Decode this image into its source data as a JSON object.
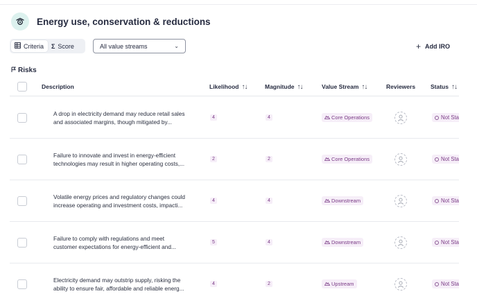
{
  "header": {
    "title": "Energy use, conservation & reductions",
    "icon": "eye-chevron-icon"
  },
  "toolbar": {
    "criteria_label": "Criteria",
    "score_label": "Score",
    "score_icon": "Σ",
    "value_stream_select": "All value streams",
    "add_label": "Add IRO"
  },
  "section": {
    "title": "Risks"
  },
  "table": {
    "columns": {
      "description": "Description",
      "likelihood": "Likelihood",
      "magnitude": "Magnitude",
      "value_stream": "Value Stream",
      "reviewers": "Reviewers",
      "status": "Status"
    },
    "rows": [
      {
        "desc1": "A drop in electricity demand may reduce retail sales",
        "desc2": "and associated margins, though mitigated by...",
        "likelihood": "4",
        "magnitude": "4",
        "value_stream": "Core Operations",
        "status": "Not Sta"
      },
      {
        "desc1": "Failure to innovate and invest in energy-efficient",
        "desc2": "technologies may result in higher operating costs,...",
        "likelihood": "2",
        "magnitude": "2",
        "value_stream": "Core Operations",
        "status": "Not Sta"
      },
      {
        "desc1": "Volatile energy prices and regulatory changes could",
        "desc2": "increase operating and investment costs, impacti...",
        "likelihood": "4",
        "magnitude": "4",
        "value_stream": "Downstream",
        "status": "Not Sta"
      },
      {
        "desc1": "Failure to comply with regulations and meet",
        "desc2": "customer expectations for energy-efficient and...",
        "likelihood": "5",
        "magnitude": "4",
        "value_stream": "Downstream",
        "status": "Not Sta"
      },
      {
        "desc1": "Electricity demand may outstrip supply, risking the",
        "desc2": "ability to ensure fair, affordable and reliable energ...",
        "likelihood": "4",
        "magnitude": "2",
        "value_stream": "Upstream",
        "status": "Not Sta"
      }
    ]
  },
  "colors": {
    "accent": "#7a3b86",
    "badge_bg": "#f6eef8",
    "header_icon_bg": "#dcf1ee"
  }
}
